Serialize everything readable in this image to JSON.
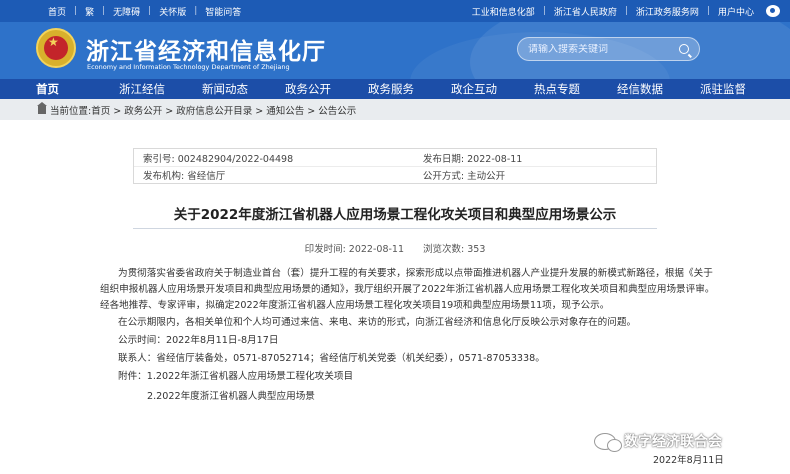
{
  "topbar": {
    "left": [
      "首页",
      "繁",
      "无障碍",
      "关怀版",
      "智能问答"
    ],
    "right": [
      "工业和信息化部",
      "浙江省人民政府",
      "浙江政务服务网",
      "用户中心"
    ]
  },
  "header": {
    "title": "浙江省经济和信息化厅",
    "subtitle": "Economy and Information Technology Department of Zhejiang",
    "search_placeholder": "请输入搜索关键词"
  },
  "nav": [
    "首页",
    "浙江经信",
    "新闻动态",
    "政务公开",
    "政务服务",
    "政企互动",
    "热点专题",
    "经信数据",
    "派驻监督"
  ],
  "breadcrumb": "当前位置:首页 > 政务公开 > 政府信息公开目录 > 通知公告 > 公告公示",
  "meta": {
    "index_no": "索引号: 002482904/2022-04498",
    "publish_date": "发布日期: 2022-08-11",
    "publisher": "发布机构: 省经信厅",
    "open_method": "公开方式: 主动公开"
  },
  "article": {
    "title": "关于2022年度浙江省机器人应用场景工程化攻关项目和典型应用场景公示",
    "print_time": "印发时间: 2022-08-11",
    "views": "浏览次数: 353",
    "para1_l1": "为贯彻落实省委省政府关于制造业首台（套）提升工程的有关要求，探索形成以点带面推进机器人产业提升发展的新模式新路径，根据《关于",
    "para1_l2": "组织申报机器人应用场景开发项目和典型应用场景的通知》，我厅组织开展了2022年浙江省机器人应用场景工程化攻关项目和典型应用场景评审。",
    "para1_l3": "经各地推荐、专家评审，拟确定2022年度浙江省机器人应用场景工程化攻关项目19项和典型应用场景11项，现予公示。",
    "para2": "在公示期限内，各相关单位和个人均可通过来信、来电、来访的形式，向浙江省经济和信息化厅反映公示对象存在的问题。",
    "period": "公示时间：2022年8月11日-8月17日",
    "contact": "联系人：省经信厅装备处，0571-87052714；省经信厅机关党委（机关纪委），0571-87053338。",
    "attach1": "附件：1.2022年浙江省机器人应用场景工程化攻关项目",
    "attach2": "2.2022年度浙江省机器人典型应用场景"
  },
  "watermark": "数字经济联合会",
  "stamp_date": "2022年8月11日"
}
